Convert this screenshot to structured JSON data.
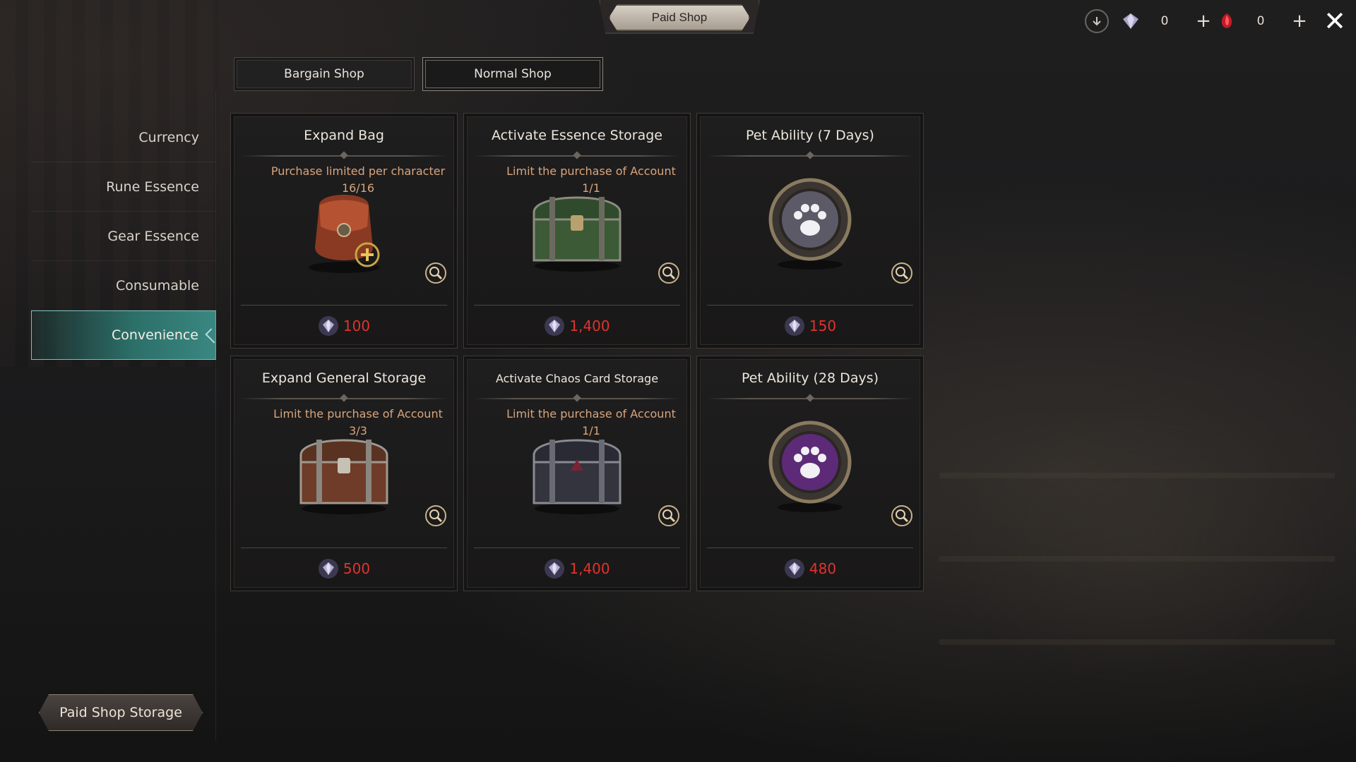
{
  "header": {
    "title": "Paid Shop"
  },
  "currencies": [
    {
      "icon": "diamond-gem-icon",
      "value": "0"
    },
    {
      "icon": "red-gem-icon",
      "value": "0"
    }
  ],
  "tabs": [
    {
      "label": "Bargain Shop",
      "active": false
    },
    {
      "label": "Normal Shop",
      "active": true
    }
  ],
  "sidebar": {
    "items": [
      {
        "label": "Currency"
      },
      {
        "label": "Rune Essence"
      },
      {
        "label": "Gear Essence"
      },
      {
        "label": "Consumable"
      },
      {
        "label": "Convenience",
        "active": true
      }
    ]
  },
  "storage_button": {
    "label": "Paid Shop Storage"
  },
  "products": [
    {
      "name": "Expand Bag",
      "limit_text": "Purchase limited per character",
      "limit_count": "16/16",
      "price": "100",
      "art": "bag"
    },
    {
      "name": "Activate Essence Storage",
      "limit_text": "Limit the purchase of Account",
      "limit_count": "1/1",
      "price": "1,400",
      "art": "green-chest"
    },
    {
      "name": "Pet Ability (7 Days)",
      "limit_text": "",
      "limit_count": "",
      "price": "150",
      "art": "paw-medallion-gray"
    },
    {
      "name": "Expand General Storage",
      "limit_text": "Limit the purchase of Account",
      "limit_count": "3/3",
      "price": "500",
      "art": "brown-chest"
    },
    {
      "name": "Activate Chaos Card Storage",
      "limit_text": "Limit the purchase of Account",
      "limit_count": "1/1",
      "price": "1,400",
      "art": "dark-chest"
    },
    {
      "name": "Pet Ability (28 Days)",
      "limit_text": "",
      "limit_count": "",
      "price": "480",
      "art": "paw-medallion-purple"
    }
  ],
  "colors": {
    "price": "#e0332f",
    "limit": "#d7a57e",
    "accent_teal": "#2c6f69"
  }
}
